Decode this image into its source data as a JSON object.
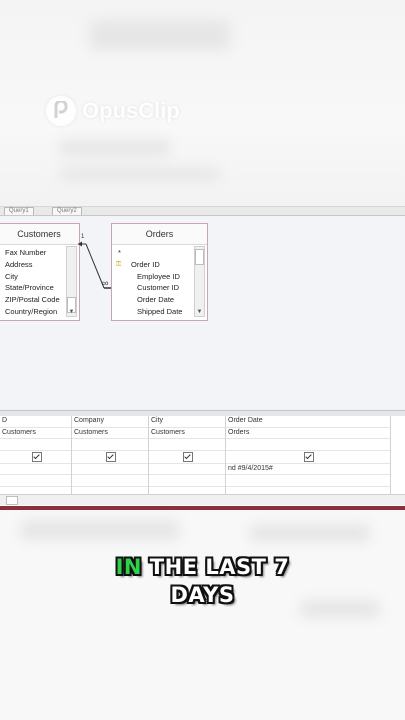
{
  "branding": {
    "logo_text": "OpusClip"
  },
  "query_tabs": [
    "Query1",
    "Query2"
  ],
  "customers_table": {
    "title": "Customers",
    "fields": [
      "Fax Number",
      "Address",
      "City",
      "State/Province",
      "ZIP/Postal Code",
      "Country/Region"
    ]
  },
  "orders_table": {
    "title": "Orders",
    "fields": [
      "*",
      "Order ID",
      "Employee ID",
      "Customer ID",
      "Order Date",
      "Shipped Date"
    ]
  },
  "relationship": {
    "one_label": "1",
    "many_label": "∞"
  },
  "grid": {
    "columns": [
      {
        "field": "D",
        "table": "Customers",
        "show": true,
        "criteria": ""
      },
      {
        "field": "Company",
        "table": "Customers",
        "show": true,
        "criteria": ""
      },
      {
        "field": "City",
        "table": "Customers",
        "show": true,
        "criteria": ""
      },
      {
        "field": "Order Date",
        "table": "Orders",
        "show": true,
        "criteria": "nd #9/4/2015#"
      }
    ]
  },
  "caption": {
    "highlight": "IN",
    "line1_rest": " THE LAST 7",
    "line2": "DAYS"
  },
  "colors": {
    "caption_highlight": "#2fd14b",
    "brand_band": "#8e2d3f"
  }
}
